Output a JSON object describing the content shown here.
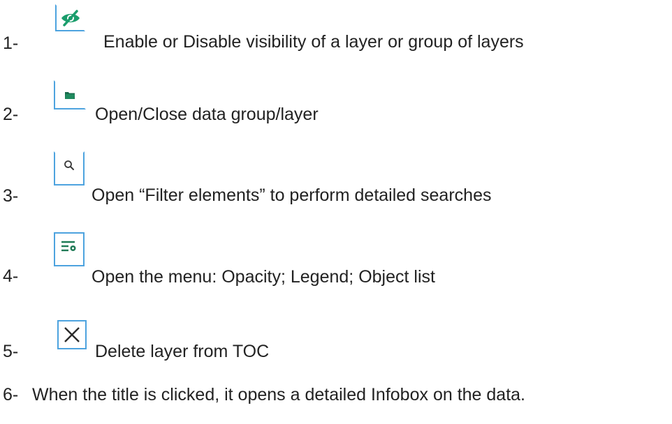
{
  "items": [
    {
      "number": "1-",
      "icon": "eye-slash-icon",
      "text": "Enable or Disable visibility of a layer or group of layers"
    },
    {
      "number": "2-",
      "icon": "folder-icon",
      "text": "Open/Close  data group/layer"
    },
    {
      "number": "3-",
      "icon": "search-icon",
      "text": "Open “Filter elements” to perform detailed searches"
    },
    {
      "number": "4-",
      "icon": "menu-settings-icon",
      "text": "Open the menu: Opacity; Legend; Object list"
    },
    {
      "number": "5-",
      "icon": "close-icon",
      "text": "Delete layer from TOC"
    },
    {
      "number": "6-",
      "icon": "",
      "text": "When the title is clicked, it opens a detailed Infobox on the data."
    }
  ],
  "colors": {
    "icon_border": "#4da3df",
    "icon_green": "#1a9d6c",
    "text": "#222222"
  }
}
